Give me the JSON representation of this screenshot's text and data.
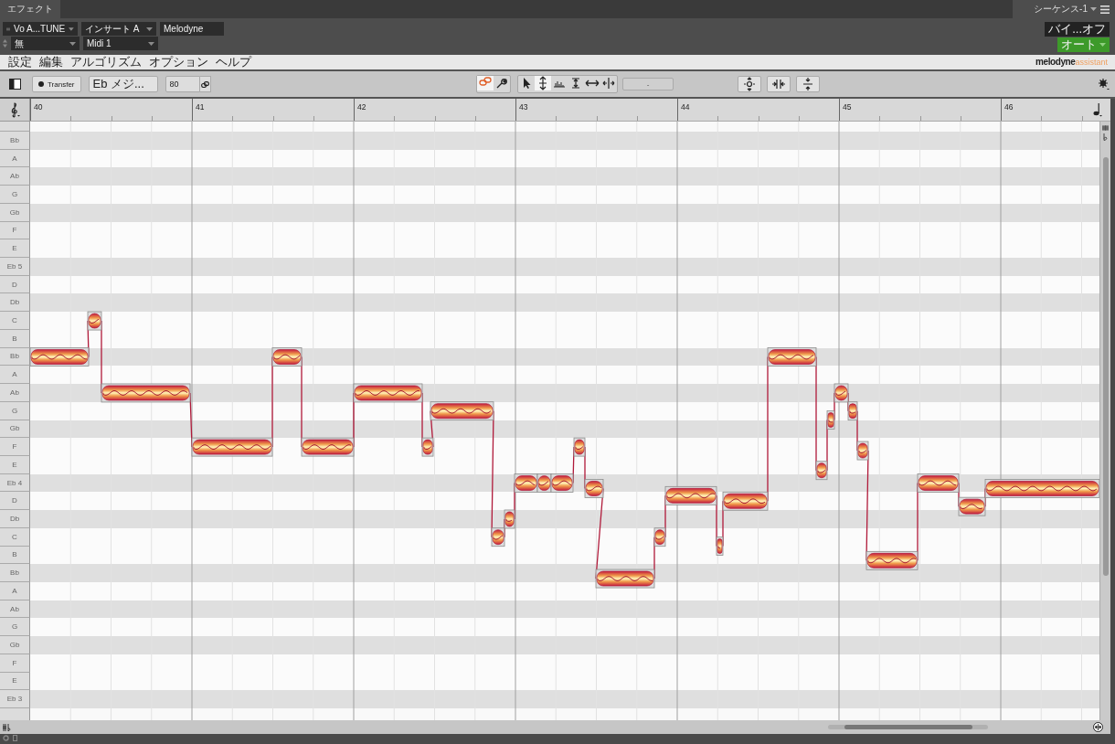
{
  "host": {
    "tab": "エフェクト",
    "sequence": "シーケンス-1",
    "track": "Vo A...TUNE",
    "insert": "インサート A",
    "plugin": "Melodyne",
    "preset": "無",
    "midi": "Midi 1",
    "bypass": "バイ...オフ",
    "automation": "オート"
  },
  "menu": [
    "設定",
    "編集",
    "アルゴリズム",
    "オプション",
    "ヘルプ"
  ],
  "brand": {
    "name": "melodyne",
    "edition": "assistant"
  },
  "toolbar": {
    "transfer": "Transfer",
    "scale": "Eb メジ...",
    "tempo": "80",
    "value_field": "-",
    "mode_tools": [
      {
        "kind": "note",
        "selected": true
      },
      {
        "kind": "wrench",
        "selected": false
      }
    ],
    "edit_tools": [
      {
        "kind": "pointer",
        "selected": false
      },
      {
        "kind": "pitch",
        "selected": true
      },
      {
        "kind": "amplitude",
        "selected": false
      },
      {
        "kind": "formant",
        "selected": false
      },
      {
        "kind": "time",
        "selected": false
      },
      {
        "kind": "split",
        "selected": false
      }
    ],
    "actions": [
      {
        "kind": "center"
      },
      {
        "kind": "quantize"
      },
      {
        "kind": "compress"
      }
    ]
  },
  "ruler": {
    "bars": [
      "40",
      "41",
      "42",
      "43",
      "44",
      "45",
      "46"
    ]
  },
  "lanes": [
    {
      "label": "Bb",
      "shaded": true
    },
    {
      "label": "A",
      "shaded": false
    },
    {
      "label": "Ab",
      "shaded": true
    },
    {
      "label": "G",
      "shaded": false
    },
    {
      "label": "Gb",
      "shaded": true
    },
    {
      "label": "F",
      "shaded": false
    },
    {
      "label": "E",
      "shaded": false
    },
    {
      "label": "Eb 5",
      "shaded": true
    },
    {
      "label": "D",
      "shaded": false
    },
    {
      "label": "Db",
      "shaded": true
    },
    {
      "label": "C",
      "shaded": false
    },
    {
      "label": "B",
      "shaded": false
    },
    {
      "label": "Bb",
      "shaded": true
    },
    {
      "label": "A",
      "shaded": false
    },
    {
      "label": "Ab",
      "shaded": true
    },
    {
      "label": "G",
      "shaded": false
    },
    {
      "label": "Gb",
      "shaded": true
    },
    {
      "label": "F",
      "shaded": false
    },
    {
      "label": "E",
      "shaded": false
    },
    {
      "label": "Eb 4",
      "shaded": true
    },
    {
      "label": "D",
      "shaded": false
    },
    {
      "label": "Db",
      "shaded": true
    },
    {
      "label": "C",
      "shaded": false
    },
    {
      "label": "B",
      "shaded": false
    },
    {
      "label": "Bb",
      "shaded": true
    },
    {
      "label": "A",
      "shaded": false
    },
    {
      "label": "Ab",
      "shaded": true
    },
    {
      "label": "G",
      "shaded": false
    },
    {
      "label": "Gb",
      "shaded": true
    },
    {
      "label": "F",
      "shaded": false
    },
    {
      "label": "E",
      "shaded": false
    },
    {
      "label": "Eb 3",
      "shaded": true
    }
  ]
}
